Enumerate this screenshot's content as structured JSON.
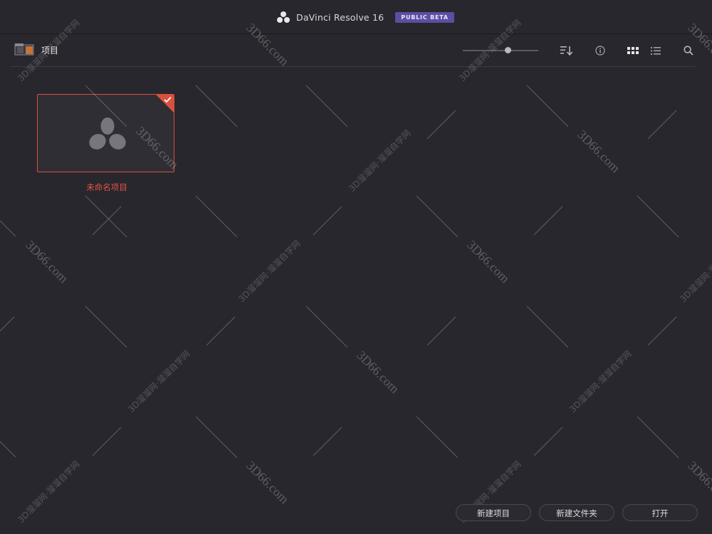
{
  "titlebar": {
    "app_title": "DaVinci Resolve 16",
    "badge": "PUBLIC BETA"
  },
  "toolbar": {
    "section_title": "项目",
    "icons": {
      "folder": "folder-icon",
      "sort": "sort-icon",
      "info": "info-icon",
      "grid_view": "grid-view-icon",
      "list_view": "list-view-icon",
      "search": "search-icon"
    },
    "zoom_level": 0.6
  },
  "projects": [
    {
      "name": "未命名项目",
      "selected": true
    }
  ],
  "footer": {
    "new_project": "新建项目",
    "new_folder": "新建文件夹",
    "open": "打开"
  },
  "watermark": {
    "domain": "3D66.com",
    "site": "3D溜溜网·溜溜自学网"
  },
  "colors": {
    "background": "#28272d",
    "accent": "#d9503e",
    "badge": "#5a4fa3"
  }
}
